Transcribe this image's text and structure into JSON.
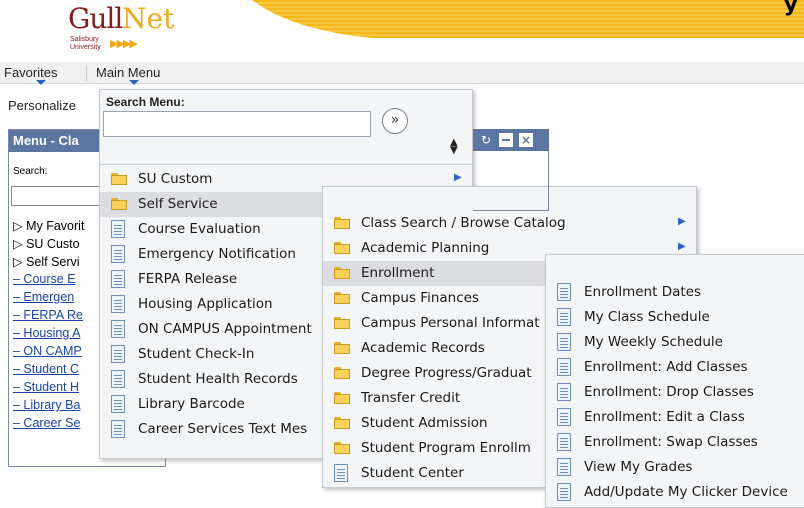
{
  "header": {
    "logo": {
      "brand_left": "Gull",
      "brand_right": "Net",
      "institution": "Salisbury University"
    },
    "banner_text": "y"
  },
  "navbar": {
    "favorites": "Favorites",
    "main_menu": "Main Menu"
  },
  "personalize": "Personalize",
  "pagelet": {
    "title": "Menu - Cla",
    "search_label": "Search:",
    "items": [
      {
        "label": "▷ My Favorit",
        "type": "folder"
      },
      {
        "label": "▷  SU Custo",
        "type": "folder"
      },
      {
        "label": "▷ Self Servi",
        "type": "folder"
      },
      {
        "label": "– Course E",
        "type": "link"
      },
      {
        "label": "– Emergen",
        "type": "link"
      },
      {
        "label": "– FERPA Re",
        "type": "link"
      },
      {
        "label": "– Housing A",
        "type": "link"
      },
      {
        "label": "– ON CAMP",
        "type": "link"
      },
      {
        "label": "– Student C",
        "type": "link"
      },
      {
        "label": "– Student H",
        "type": "link"
      },
      {
        "label": "– Library Ba",
        "type": "link"
      },
      {
        "label": "– Career Se",
        "type": "link"
      }
    ]
  },
  "main_menu": {
    "search_label": "Search Menu:",
    "search_value": "",
    "go_symbol": "»",
    "items": [
      {
        "label": "SU Custom",
        "icon": "folder-icon",
        "submenu": true
      },
      {
        "label": "Self Service",
        "icon": "folder-icon",
        "submenu": false,
        "highlighted": true
      },
      {
        "label": "Course Evaluation",
        "icon": "page-icon"
      },
      {
        "label": "Emergency Notification",
        "icon": "page-icon"
      },
      {
        "label": "FERPA Release",
        "icon": "page-icon"
      },
      {
        "label": "Housing Application",
        "icon": "page-icon"
      },
      {
        "label": "ON CAMPUS Appointment",
        "icon": "page-icon"
      },
      {
        "label": "Student Check-In",
        "icon": "page-icon"
      },
      {
        "label": "Student Health Records",
        "icon": "page-icon"
      },
      {
        "label": "Library Barcode",
        "icon": "page-icon"
      },
      {
        "label": "Career Services Text Mes",
        "icon": "page-icon"
      }
    ]
  },
  "self_service_menu": {
    "items": [
      {
        "label": "Class Search / Browse Catalog",
        "icon": "folder-icon",
        "submenu": true
      },
      {
        "label": "Academic Planning",
        "icon": "folder-icon",
        "submenu": true
      },
      {
        "label": "Enrollment",
        "icon": "folder-icon",
        "highlighted": true
      },
      {
        "label": "Campus Finances",
        "icon": "folder-icon"
      },
      {
        "label": "Campus Personal Informat",
        "icon": "folder-icon"
      },
      {
        "label": "Academic Records",
        "icon": "folder-icon"
      },
      {
        "label": "Degree Progress/Graduat",
        "icon": "folder-icon"
      },
      {
        "label": "Transfer Credit",
        "icon": "folder-icon"
      },
      {
        "label": "Student Admission",
        "icon": "folder-icon"
      },
      {
        "label": "Student Program Enrollm",
        "icon": "folder-icon"
      },
      {
        "label": "Student Center",
        "icon": "page-icon"
      }
    ]
  },
  "enrollment_menu": {
    "items": [
      {
        "label": "Enrollment Dates",
        "icon": "page-icon"
      },
      {
        "label": "My Class Schedule",
        "icon": "page-icon"
      },
      {
        "label": "My Weekly Schedule",
        "icon": "page-icon"
      },
      {
        "label": "Enrollment: Add Classes",
        "icon": "page-icon"
      },
      {
        "label": "Enrollment: Drop Classes",
        "icon": "page-icon"
      },
      {
        "label": "Enrollment: Edit a Class",
        "icon": "page-icon"
      },
      {
        "label": "Enrollment: Swap Classes",
        "icon": "page-icon"
      },
      {
        "label": "View My Grades",
        "icon": "page-icon"
      },
      {
        "label": "Add/Update My Clicker Device",
        "icon": "page-icon"
      }
    ]
  },
  "colors": {
    "banner": "#f5b71d",
    "pagelet_header": "#5c76a2",
    "highlight": "#dcdde3",
    "folder": "#f6d25a",
    "link": "#1a44a8"
  }
}
